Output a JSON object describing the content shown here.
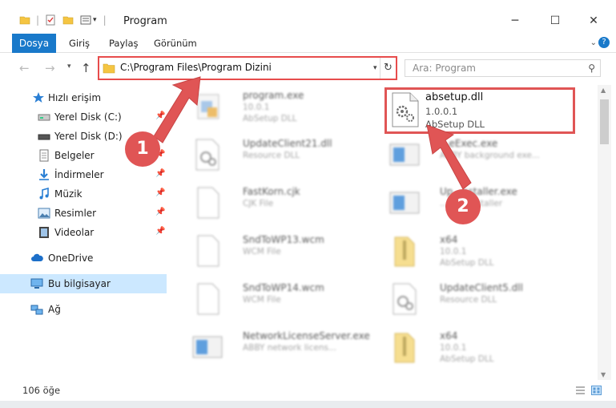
{
  "window": {
    "title": "Program",
    "minimize_glyph": "─",
    "maximize_glyph": "☐",
    "close_glyph": "✕"
  },
  "ribbon": {
    "file_tab": "Dosya",
    "tabs": [
      "Giriş",
      "Paylaş",
      "Görünüm"
    ]
  },
  "address": {
    "path": "C:\\Program Files\\Program Dizini"
  },
  "search": {
    "placeholder": "Ara: Program"
  },
  "sidebar": {
    "items": [
      {
        "label": "Hızlı erişim",
        "icon": "star-icon"
      },
      {
        "label": "Yerel Disk (C:)",
        "icon": "drive-icon",
        "pinned": true
      },
      {
        "label": "Yerel Disk (D:)",
        "icon": "drive-icon",
        "pinned": true
      },
      {
        "label": "Belgeler",
        "icon": "documents-icon",
        "pinned": true
      },
      {
        "label": "İndirmeler",
        "icon": "download-icon",
        "pinned": true
      },
      {
        "label": "Müzik",
        "icon": "music-icon",
        "pinned": true
      },
      {
        "label": "Resimler",
        "icon": "pictures-icon",
        "pinned": true
      },
      {
        "label": "Videolar",
        "icon": "videos-icon",
        "pinned": true
      },
      {
        "label": "OneDrive",
        "icon": "cloud-icon"
      },
      {
        "label": "Bu bilgisayar",
        "icon": "computer-icon",
        "selected": true
      },
      {
        "label": "Ağ",
        "icon": "network-icon"
      }
    ]
  },
  "files": [
    {
      "name": "program.exe",
      "sub1": "10.0.1",
      "sub2": "AbSetup DLL"
    },
    {
      "name": "UpdateClient21.dll",
      "sub1": "Resource DLL",
      "sub2": ""
    },
    {
      "name": "FastKorn.cjk",
      "sub1": "CJK File",
      "sub2": ""
    },
    {
      "name": "SndToWP13.wcm",
      "sub1": "WCM File",
      "sub2": ""
    },
    {
      "name": "SndToWP14.wcm",
      "sub1": "WCM File",
      "sub2": ""
    },
    {
      "name": "NetworkLicenseServer.exe",
      "sub1": "ABBY network licens...",
      "sub2": ""
    },
    {
      "name": "...eExec.exe",
      "sub1": "ABBY background exe...",
      "sub2": ""
    },
    {
      "name": "Up...nstaller.exe",
      "sub1": "...ates installer",
      "sub2": ""
    },
    {
      "name": "x64",
      "sub1": "10.0.1",
      "sub2": "AbSetup DLL"
    },
    {
      "name": "UpdateClient5.dll",
      "sub1": "Resource DLL",
      "sub2": ""
    },
    {
      "name": "x64",
      "sub1": "10.0.1",
      "sub2": "AbSetup DLL"
    }
  ],
  "highlighted_file": {
    "name": "absetup.dll",
    "version": "1.0.0.1",
    "description": "AbSetup DLL"
  },
  "status": {
    "count": "106 öğe"
  },
  "annotations": {
    "badge1": "1",
    "badge2": "2",
    "color": "#e05555"
  }
}
